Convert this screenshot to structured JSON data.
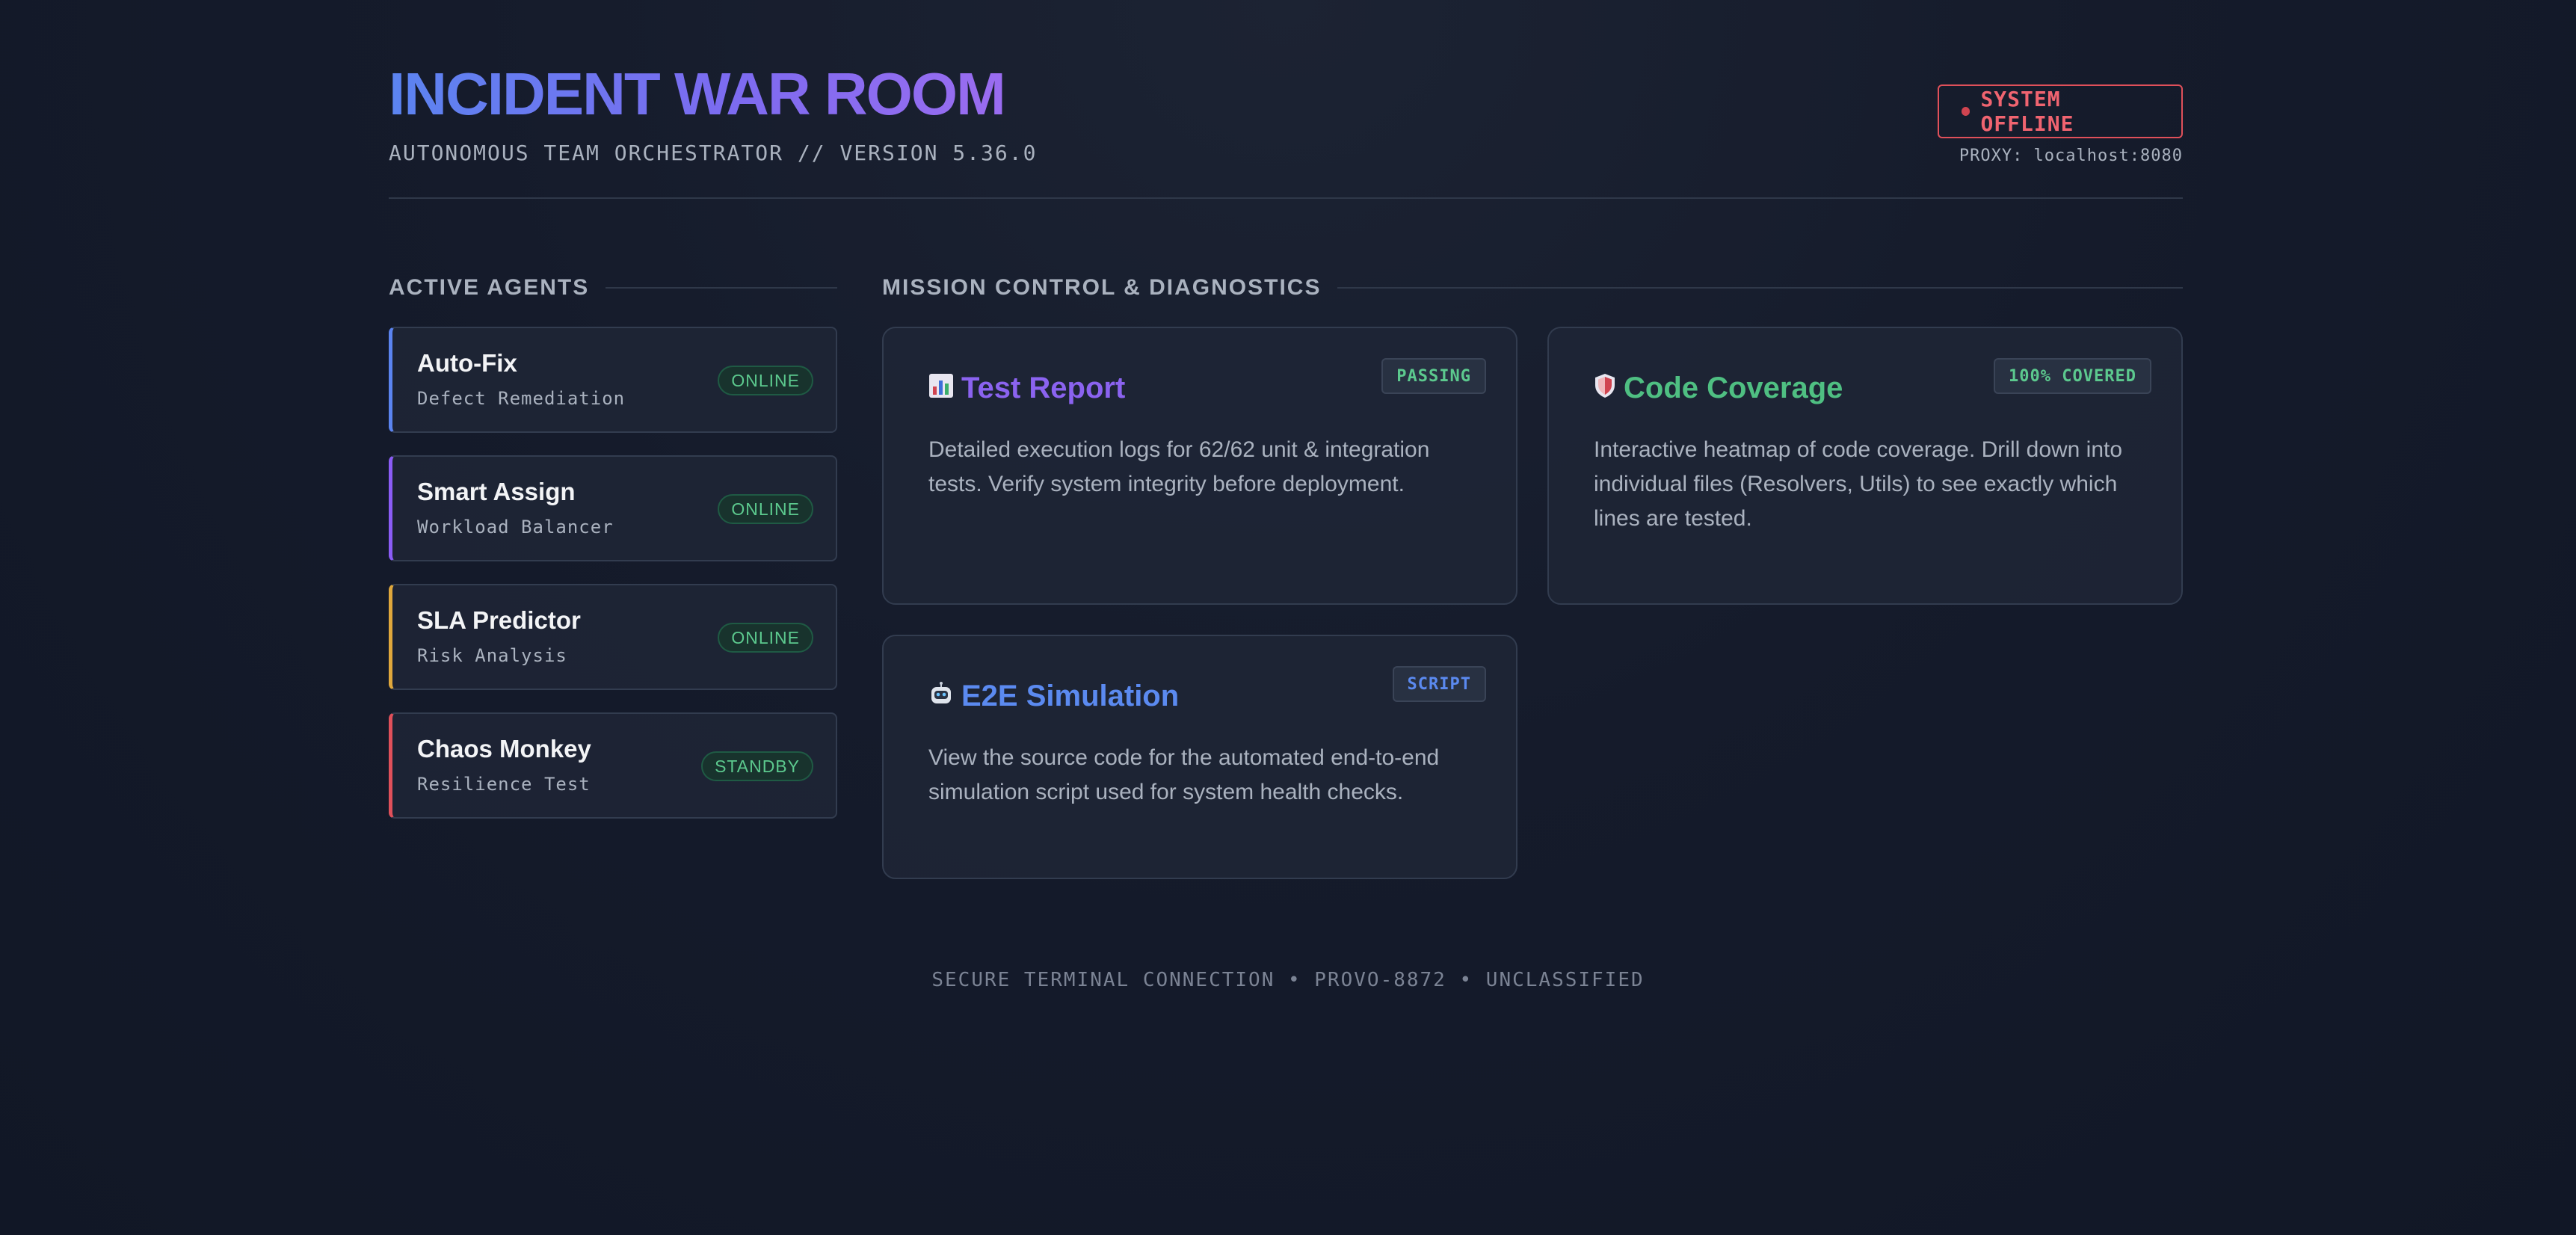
{
  "header": {
    "title": "INCIDENT WAR ROOM",
    "subtitle": "AUTONOMOUS TEAM ORCHESTRATOR // VERSION 5.36.0",
    "status": "SYSTEM OFFLINE",
    "proxy": "PROXY: localhost:8080"
  },
  "agents_section": {
    "heading": "ACTIVE AGENTS",
    "items": [
      {
        "name": "Auto-Fix",
        "role": "Defect Remediation",
        "status": "ONLINE",
        "accent": "#5b84f0"
      },
      {
        "name": "Smart Assign",
        "role": "Workload Balancer",
        "status": "ONLINE",
        "accent": "#8b5cf6"
      },
      {
        "name": "SLA Predictor",
        "role": "Risk Analysis",
        "status": "ONLINE",
        "accent": "#e0a83c"
      },
      {
        "name": "Chaos Monkey",
        "role": "Resilience Test",
        "status": "STANDBY",
        "accent": "#e0505a"
      }
    ]
  },
  "mission_section": {
    "heading": "MISSION CONTROL & DIAGNOSTICS",
    "cards": [
      {
        "icon": "bar-chart-icon",
        "title": "Test Report",
        "tag": "PASSING",
        "description": "Detailed execution logs for 62/62 unit & integration tests. Verify system integrity before deployment."
      },
      {
        "icon": "shield-icon",
        "title": "Code Coverage",
        "tag": "100% COVERED",
        "description": "Interactive heatmap of code coverage. Drill down into individual files (Resolvers, Utils) to see exactly which lines are tested."
      },
      {
        "icon": "robot-icon",
        "title": "E2E Simulation",
        "tag": "SCRIPT",
        "description": "View the source code for the automated end-to-end simulation script used for system health checks."
      }
    ]
  },
  "footer": {
    "text": "SECURE TERMINAL CONNECTION • PROVO-8872 • UNCLASSIFIED"
  },
  "colors": {
    "background": "#151b2b",
    "offline": "#e0505a",
    "online": "#5cc98e",
    "title_gradient_start": "#5b84f0",
    "title_gradient_end": "#9a6cf0"
  }
}
